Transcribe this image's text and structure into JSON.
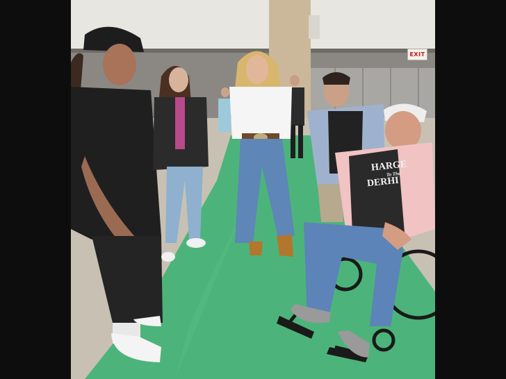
{
  "scene": {
    "exit_sign_text": "EXIT",
    "shirt_text": {
      "line1": "HARGE",
      "line2": "To The",
      "line3": "DERHI"
    }
  },
  "colors": {
    "frame": "#0d0d0d",
    "carpet": "#4db57a",
    "floor": "#c9c2b4",
    "wall": "#8a8782",
    "ceiling": "#e9e7e2"
  }
}
